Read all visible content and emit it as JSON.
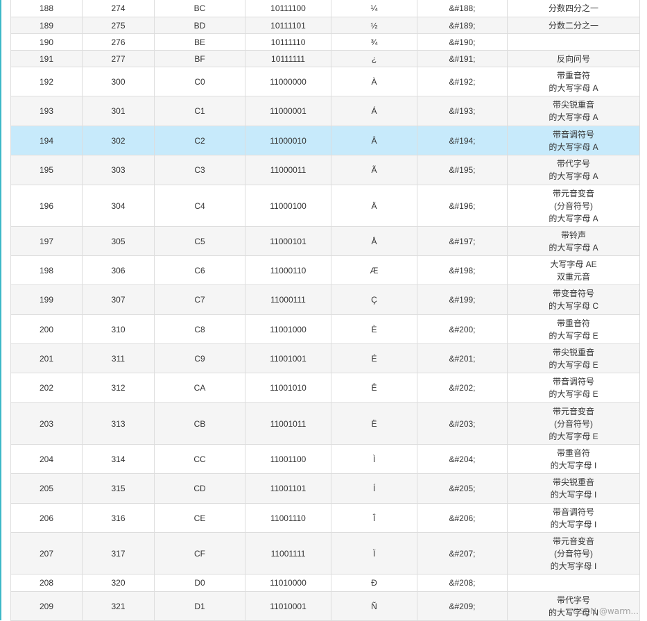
{
  "table": {
    "rows": [
      {
        "dec": "188",
        "oct": "274",
        "hex": "BC",
        "bin": "10111100",
        "char": "¼",
        "entity": "&#188;",
        "desc": [
          "分数四分之一"
        ],
        "highlight": false
      },
      {
        "dec": "189",
        "oct": "275",
        "hex": "BD",
        "bin": "10111101",
        "char": "½",
        "entity": "&#189;",
        "desc": [
          "分数二分之一"
        ],
        "highlight": false
      },
      {
        "dec": "190",
        "oct": "276",
        "hex": "BE",
        "bin": "10111110",
        "char": "¾",
        "entity": "&#190;",
        "desc": [],
        "highlight": false
      },
      {
        "dec": "191",
        "oct": "277",
        "hex": "BF",
        "bin": "10111111",
        "char": "¿",
        "entity": "&#191;",
        "desc": [
          "反向问号"
        ],
        "highlight": false
      },
      {
        "dec": "192",
        "oct": "300",
        "hex": "C0",
        "bin": "11000000",
        "char": "À",
        "entity": "&#192;",
        "desc": [
          "带重音符",
          "的大写字母 A"
        ],
        "highlight": false
      },
      {
        "dec": "193",
        "oct": "301",
        "hex": "C1",
        "bin": "11000001",
        "char": "Á",
        "entity": "&#193;",
        "desc": [
          "带尖锐重音",
          "的大写字母 A"
        ],
        "highlight": false
      },
      {
        "dec": "194",
        "oct": "302",
        "hex": "C2",
        "bin": "11000010",
        "char": "Â",
        "entity": "&#194;",
        "desc": [
          "带音调符号",
          "的大写字母 A"
        ],
        "highlight": true
      },
      {
        "dec": "195",
        "oct": "303",
        "hex": "C3",
        "bin": "11000011",
        "char": "Ã",
        "entity": "&#195;",
        "desc": [
          "带代字号",
          "的大写字母 A"
        ],
        "highlight": false
      },
      {
        "dec": "196",
        "oct": "304",
        "hex": "C4",
        "bin": "11000100",
        "char": "Ä",
        "entity": "&#196;",
        "desc": [
          "带元音变音",
          "(分音符号)",
          "的大写字母 A"
        ],
        "highlight": false
      },
      {
        "dec": "197",
        "oct": "305",
        "hex": "C5",
        "bin": "11000101",
        "char": "Å",
        "entity": "&#197;",
        "desc": [
          "带铃声",
          "的大写字母 A"
        ],
        "highlight": false
      },
      {
        "dec": "198",
        "oct": "306",
        "hex": "C6",
        "bin": "11000110",
        "char": "Æ",
        "entity": "&#198;",
        "desc": [
          "大写字母 AE",
          "双重元音"
        ],
        "highlight": false
      },
      {
        "dec": "199",
        "oct": "307",
        "hex": "C7",
        "bin": "11000111",
        "char": "Ç",
        "entity": "&#199;",
        "desc": [
          "带变音符号",
          "的大写字母 C"
        ],
        "highlight": false
      },
      {
        "dec": "200",
        "oct": "310",
        "hex": "C8",
        "bin": "11001000",
        "char": "È",
        "entity": "&#200;",
        "desc": [
          "带重音符",
          "的大写字母 E"
        ],
        "highlight": false
      },
      {
        "dec": "201",
        "oct": "311",
        "hex": "C9",
        "bin": "11001001",
        "char": "É",
        "entity": "&#201;",
        "desc": [
          "带尖锐重音",
          "的大写字母 E"
        ],
        "highlight": false
      },
      {
        "dec": "202",
        "oct": "312",
        "hex": "CA",
        "bin": "11001010",
        "char": "Ê",
        "entity": "&#202;",
        "desc": [
          "带音调符号",
          "的大写字母 E"
        ],
        "highlight": false
      },
      {
        "dec": "203",
        "oct": "313",
        "hex": "CB",
        "bin": "11001011",
        "char": "Ë",
        "entity": "&#203;",
        "desc": [
          "带元音变音",
          "(分音符号)",
          "的大写字母 E"
        ],
        "highlight": false
      },
      {
        "dec": "204",
        "oct": "314",
        "hex": "CC",
        "bin": "11001100",
        "char": "Ì",
        "entity": "&#204;",
        "desc": [
          "带重音符",
          "的大写字母 I"
        ],
        "highlight": false
      },
      {
        "dec": "205",
        "oct": "315",
        "hex": "CD",
        "bin": "11001101",
        "char": "Í",
        "entity": "&#205;",
        "desc": [
          "带尖锐重音",
          "的大写字母 I"
        ],
        "highlight": false
      },
      {
        "dec": "206",
        "oct": "316",
        "hex": "CE",
        "bin": "11001110",
        "char": "Î",
        "entity": "&#206;",
        "desc": [
          "带音调符号",
          "的大写字母 I"
        ],
        "highlight": false
      },
      {
        "dec": "207",
        "oct": "317",
        "hex": "CF",
        "bin": "11001111",
        "char": "Ï",
        "entity": "&#207;",
        "desc": [
          "带元音变音",
          "(分音符号)",
          "的大写字母 I"
        ],
        "highlight": false
      },
      {
        "dec": "208",
        "oct": "320",
        "hex": "D0",
        "bin": "11010000",
        "char": "Ð",
        "entity": "&#208;",
        "desc": [],
        "highlight": false
      },
      {
        "dec": "209",
        "oct": "321",
        "hex": "D1",
        "bin": "11010001",
        "char": "Ñ",
        "entity": "&#209;",
        "desc": [
          "带代字号",
          "的大写字母 N"
        ],
        "highlight": false
      }
    ]
  },
  "watermark": "CSDN @warm...",
  "colors": {
    "border": "#dddddd",
    "row_alt": "#f5f5f5",
    "row_highlight": "#c7eafb",
    "left_accent": "#3db8c8"
  }
}
